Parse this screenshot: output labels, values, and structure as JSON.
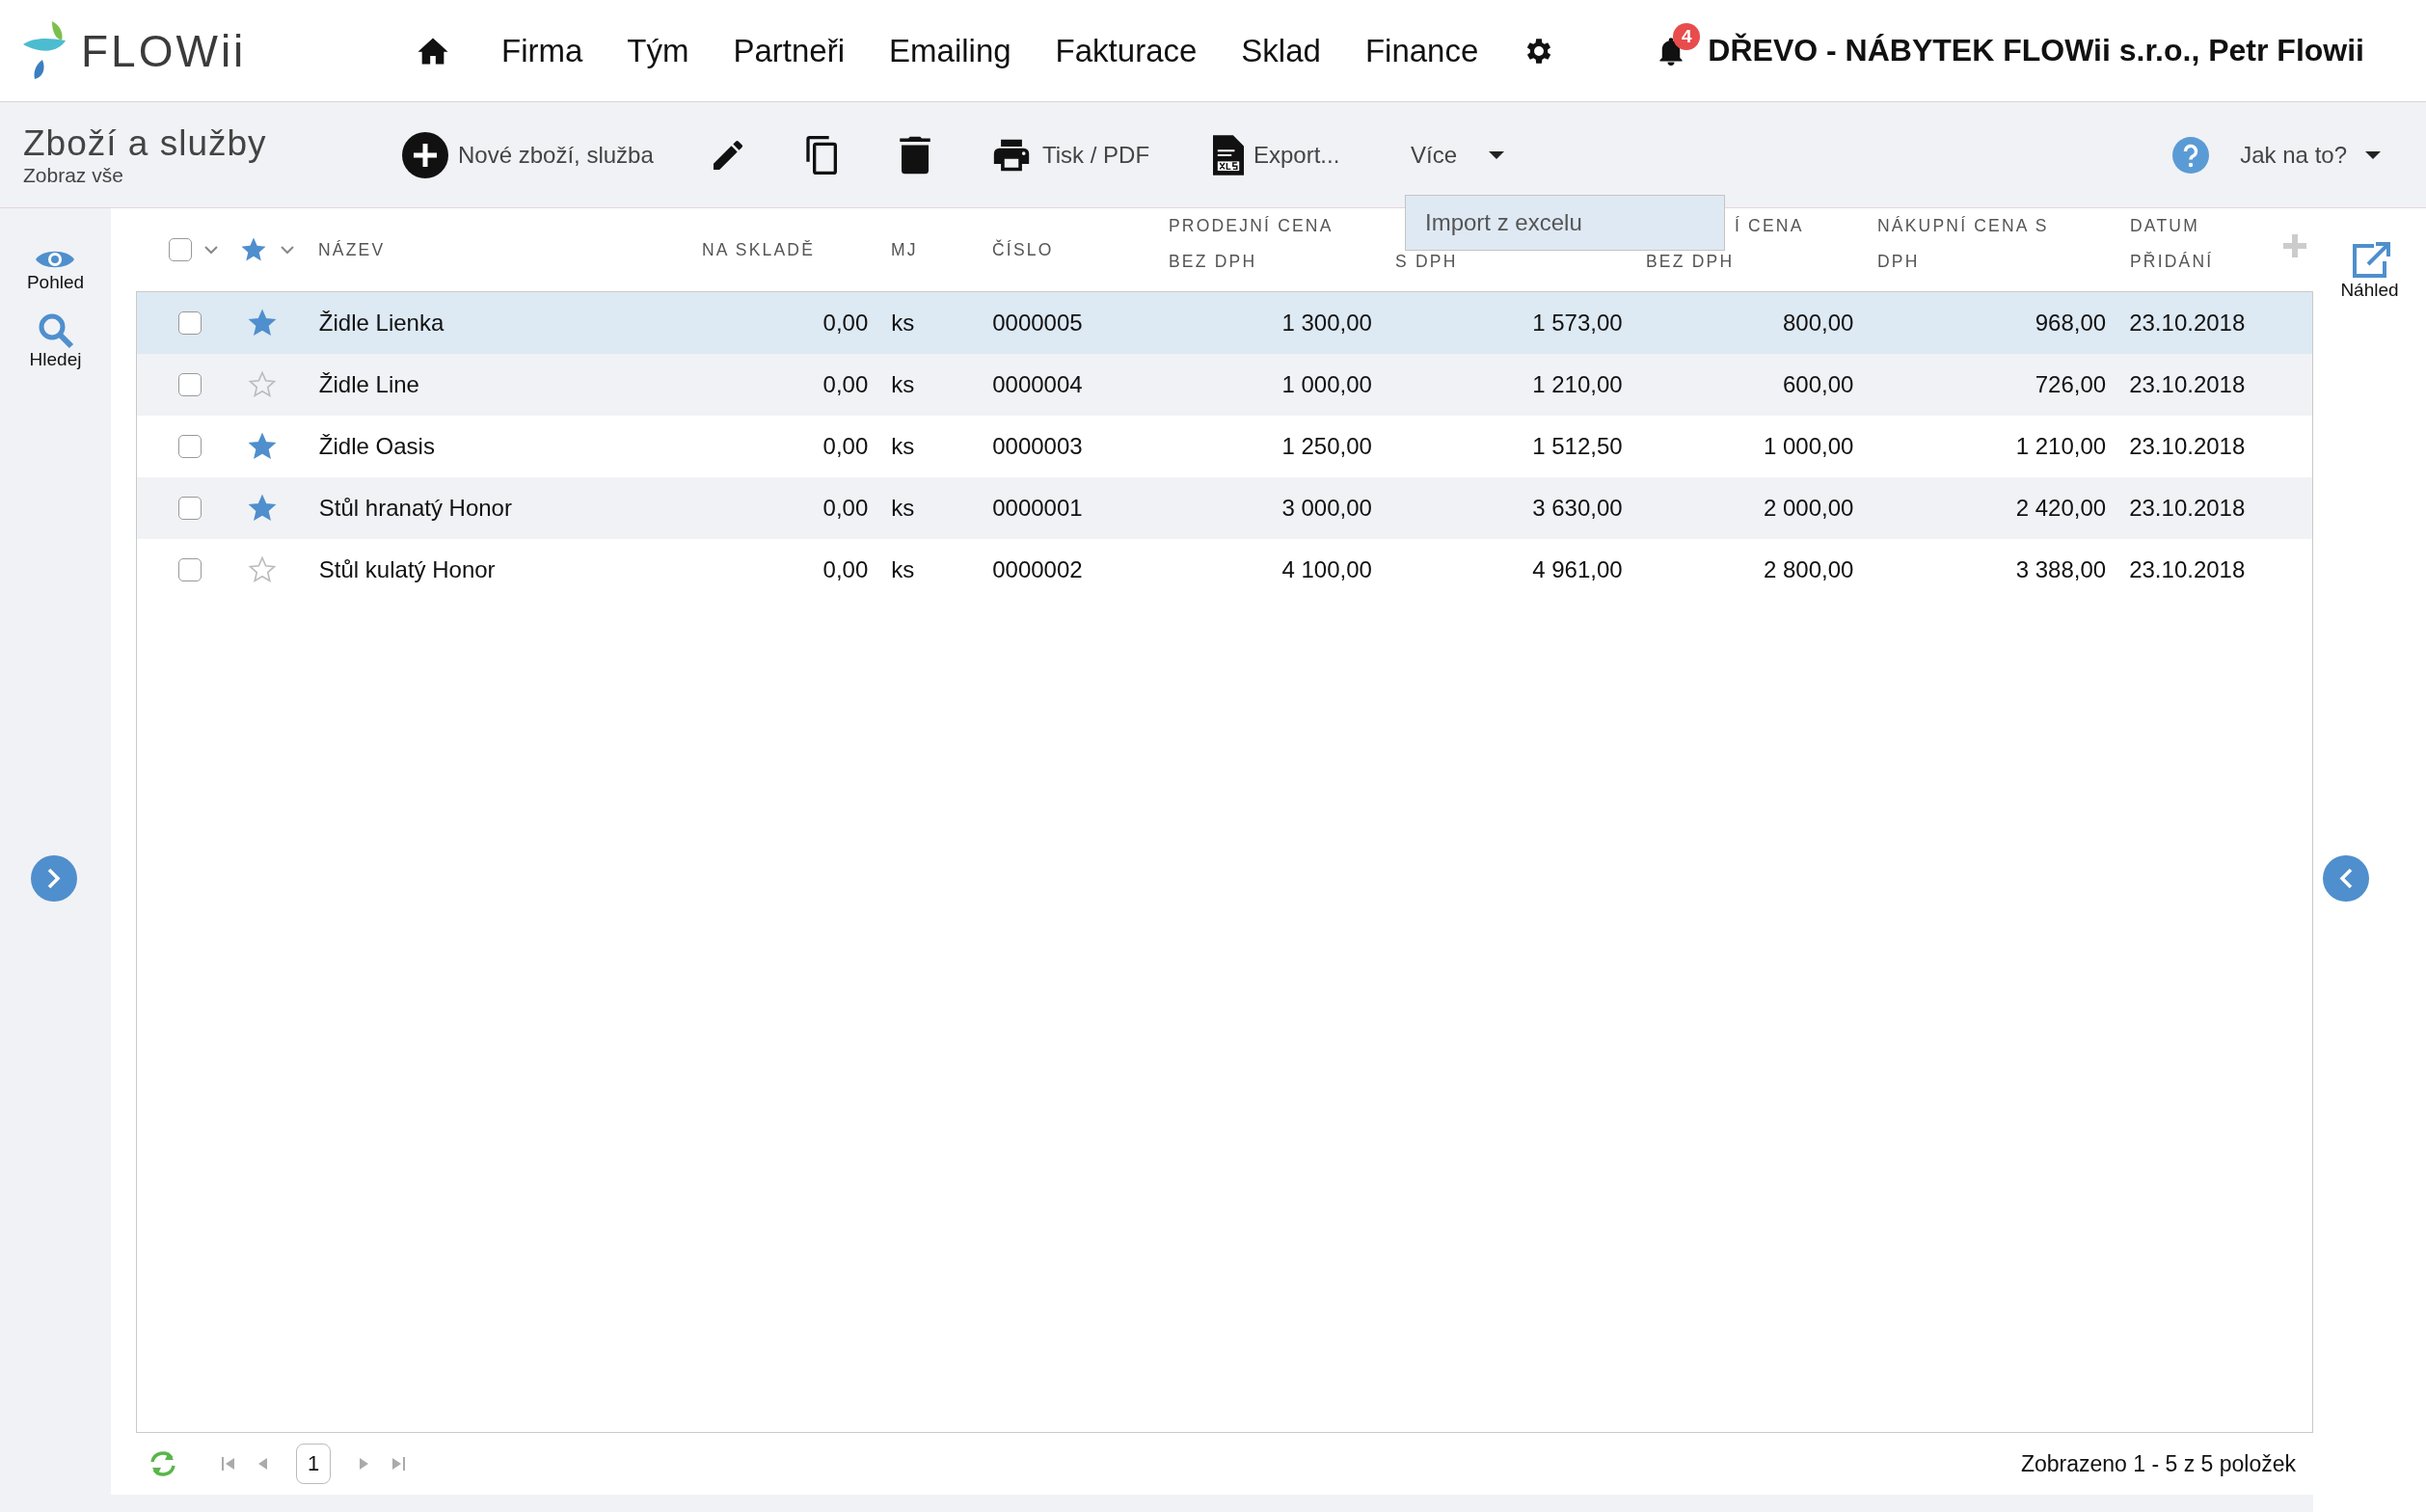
{
  "header": {
    "brand": "FLOWii",
    "nav": [
      {
        "label": "Firma"
      },
      {
        "label": "Tým"
      },
      {
        "label": "Partneři"
      },
      {
        "label": "Emailing"
      },
      {
        "label": "Fakturace"
      },
      {
        "label": "Sklad"
      },
      {
        "label": "Finance"
      }
    ],
    "notifications": "4",
    "account": "DŘEVO - NÁBYTEK FLOWii s.r.o., Petr Flowii"
  },
  "toolbar": {
    "title": "Zboží a služby",
    "subtitle": "Zobraz vše",
    "actions": [
      {
        "kind": "new",
        "label": "Nové zboží, služba"
      },
      {
        "kind": "edit"
      },
      {
        "kind": "copy"
      },
      {
        "kind": "delete"
      },
      {
        "kind": "print",
        "label": "Tisk / PDF"
      },
      {
        "kind": "export",
        "label": "Export..."
      },
      {
        "kind": "more",
        "label": "Více"
      }
    ],
    "help": "Jak na to?"
  },
  "more_menu": {
    "items": [
      "Import z excelu"
    ]
  },
  "sidebar": [
    {
      "kind": "view",
      "label": "Pohled"
    },
    {
      "kind": "search",
      "label": "Hledej"
    }
  ],
  "preview": {
    "label": "Náhled"
  },
  "table": {
    "select_all_checked": false,
    "columns": [
      {
        "lines": [
          "NÁZEV"
        ]
      },
      {
        "lines": [
          "NA SKLADĚ"
        ]
      },
      {
        "lines": [
          "MJ"
        ]
      },
      {
        "lines": [
          "ČÍSLO"
        ]
      },
      {
        "lines": [
          "PRODEJNÍ CENA",
          "BEZ DPH"
        ]
      },
      {
        "lines": [
          "S DPH"
        ]
      },
      {
        "lines": [
          "Í CENA",
          "BEZ DPH"
        ]
      },
      {
        "lines": [
          "NÁKUPNÍ CENA S",
          "DPH"
        ]
      },
      {
        "lines": [
          "DATUM",
          "PŘIDÁNÍ"
        ]
      }
    ],
    "rows": [
      {
        "selected": true,
        "checked": false,
        "favorite": true,
        "cells": [
          "Židle Lienka",
          "0,00",
          "ks",
          "0000005",
          "1 300,00",
          "1 573,00",
          "800,00",
          "968,00",
          "23.10.2018"
        ]
      },
      {
        "selected": false,
        "checked": false,
        "favorite": false,
        "cells": [
          "Židle Line",
          "0,00",
          "ks",
          "0000004",
          "1 000,00",
          "1 210,00",
          "600,00",
          "726,00",
          "23.10.2018"
        ]
      },
      {
        "selected": false,
        "checked": false,
        "favorite": true,
        "cells": [
          "Židle Oasis",
          "0,00",
          "ks",
          "0000003",
          "1 250,00",
          "1 512,50",
          "1 000,00",
          "1 210,00",
          "23.10.2018"
        ]
      },
      {
        "selected": false,
        "checked": false,
        "favorite": true,
        "cells": [
          "Stůl hranatý Honor",
          "0,00",
          "ks",
          "0000001",
          "3 000,00",
          "3 630,00",
          "2 000,00",
          "2 420,00",
          "23.10.2018"
        ]
      },
      {
        "selected": false,
        "checked": false,
        "favorite": false,
        "cells": [
          "Stůl kulatý Honor",
          "0,00",
          "ks",
          "0000002",
          "4 100,00",
          "4 961,00",
          "2 800,00",
          "3 388,00",
          "23.10.2018"
        ]
      }
    ]
  },
  "footer": {
    "page": "1",
    "summary": "Zobrazeno 1 - 5 z 5 položek"
  }
}
